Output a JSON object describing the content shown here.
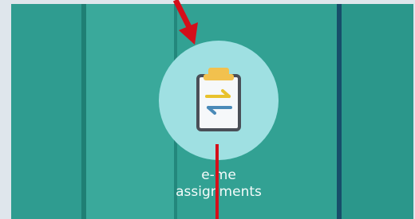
{
  "app_tile": {
    "icon_name": "clipboard-transfer-icon",
    "label_line1": "e-me",
    "label_line2": "assignments"
  },
  "annotations": {
    "arrow_color": "#d40f1a",
    "arrow_icon": "down-pointing-arrow",
    "guide_line_color": "#d40f1a"
  },
  "colors": {
    "background": "#2e9a8e",
    "icon_circle": "#9fe0e2",
    "clip": "#f2c14e",
    "board_border": "#4a4f57",
    "arrow_yellow": "#e8c22d",
    "arrow_blue": "#4a8ab8",
    "label": "#f4fbfa"
  }
}
